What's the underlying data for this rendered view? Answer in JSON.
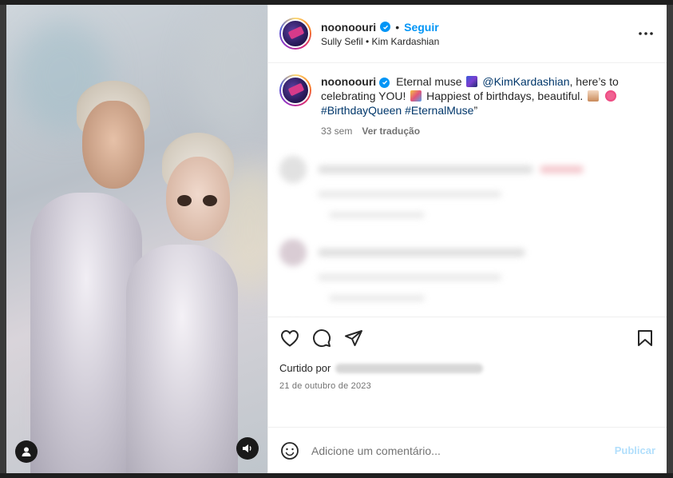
{
  "post": {
    "username": "noonoouri",
    "follow_label": "Seguir",
    "separator": "•",
    "subtitle": "Sully Sefil • Kim Kardashian",
    "caption": {
      "username": "noonoouri",
      "text_1": "Eternal muse",
      "mention": "@KimKardashian",
      "text_2": ", here’s to celebrating YOU!",
      "text_3": "Happiest of birthdays, beautiful.",
      "hashtags": "#BirthdayQueen #EternalMuse",
      "closing_quote": "”"
    },
    "time_ago": "33 sem",
    "translate_label": "Ver tradução",
    "liked_by_label": "Curtido por",
    "date": "21 de outubro de 2023"
  },
  "comment_bar": {
    "placeholder": "Adicione um comentário...",
    "post_label": "Publicar"
  },
  "icons": {
    "more": "more-horizontal-icon",
    "like": "heart-icon",
    "comment": "comment-icon",
    "share": "send-icon",
    "save": "bookmark-icon",
    "emoji": "emoji-icon",
    "user_tag": "user-icon",
    "audio": "speaker-icon",
    "verified": "verified-badge-icon"
  },
  "colors": {
    "accent": "#0095f6",
    "link": "#00376b",
    "muted": "#737373",
    "post_disabled": "#b2dffc"
  }
}
